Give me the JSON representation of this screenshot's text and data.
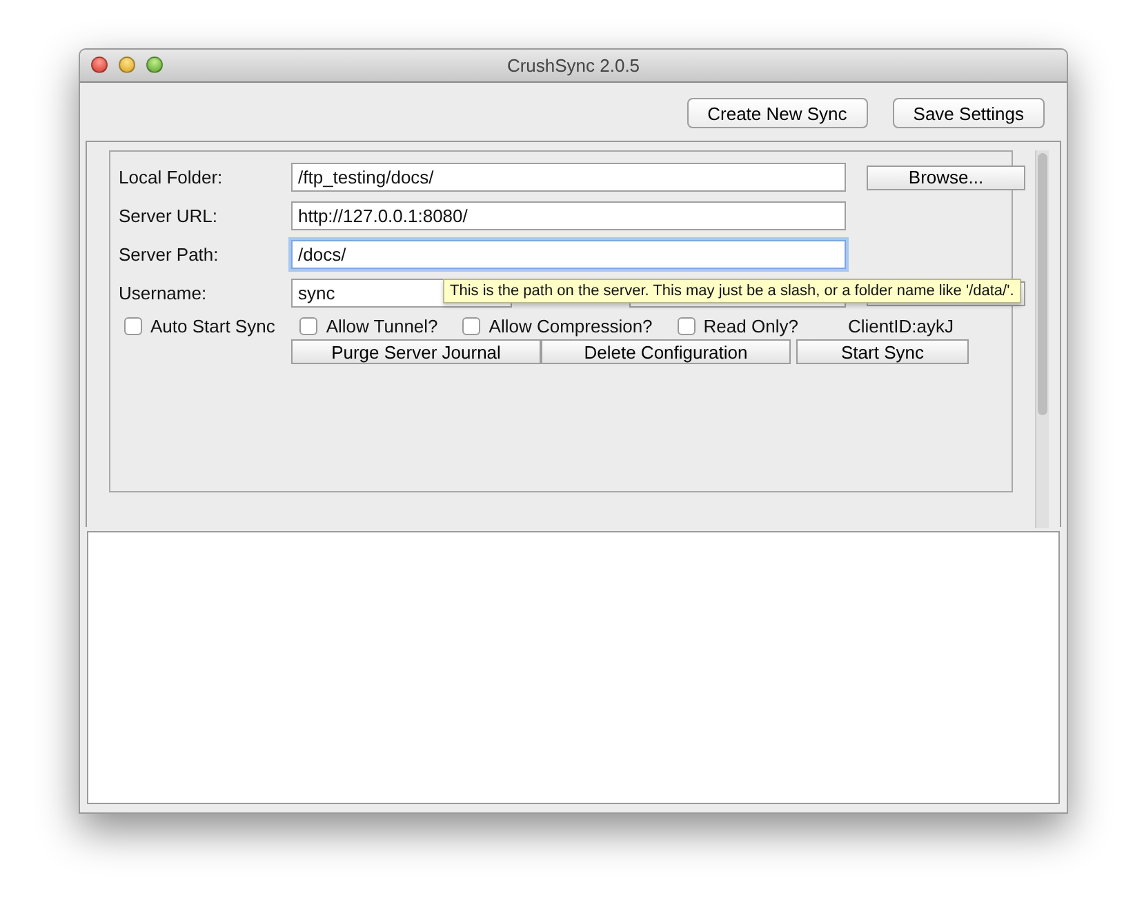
{
  "window": {
    "title": "CrushSync 2.0.5"
  },
  "toolbar": {
    "buttons": [
      "Create New Sync",
      "Save Settings"
    ]
  },
  "form": {
    "fields": [
      {
        "label": "Local Folder:",
        "value": "/ftp_testing/docs/",
        "focused": false
      },
      {
        "label": "Server URL:",
        "value": "http://127.0.0.1:8080/",
        "focused": false
      },
      {
        "label": "Server Path:",
        "value": "/docs/",
        "focused": true
      },
      {
        "label": "Username:",
        "value": "sync",
        "focused": false
      }
    ],
    "browse_button": "Browse...",
    "checkboxes": [
      {
        "label": "Auto Start Sync",
        "checked": false
      },
      {
        "label": "Allow Tunnel?",
        "checked": false
      },
      {
        "label": "Allow Compression?",
        "checked": false
      },
      {
        "label": "Read Only?",
        "checked": false
      }
    ],
    "client_id": "ClientID:aykJ",
    "actions": [
      "Purge Server Journal",
      "Delete Configuration"
    ],
    "start_button": "Start Sync"
  },
  "tooltip": "This is the path on the server.  This may just be a slash, or a folder name like '/data/'."
}
